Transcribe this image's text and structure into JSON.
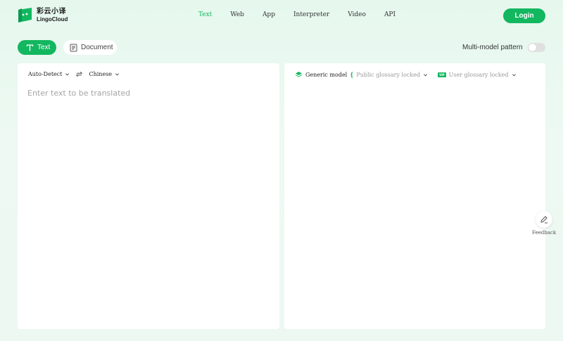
{
  "brand": {
    "name_cn": "彩云小译",
    "name_en": "LingoCloud",
    "color": "#12b760"
  },
  "nav": {
    "items": [
      {
        "label": "Text",
        "active": true
      },
      {
        "label": "Web"
      },
      {
        "label": "App"
      },
      {
        "label": "Interpreter"
      },
      {
        "label": "Video"
      },
      {
        "label": "API"
      }
    ]
  },
  "header": {
    "login_label": "Login"
  },
  "modes": {
    "text_label": "Text",
    "document_label": "Document"
  },
  "multi_model": {
    "label": "Multi-model pattern",
    "enabled": false
  },
  "source": {
    "from_lang": "Auto-Detect",
    "to_lang": "Chinese",
    "placeholder": "Enter text to be translated",
    "value": ""
  },
  "target": {
    "model": "Generic model",
    "public_glossary": "Public glossary locked",
    "user_glossary": "User glossary locked",
    "vip_badge": "VIP"
  },
  "feedback": {
    "label": "Feedback"
  }
}
